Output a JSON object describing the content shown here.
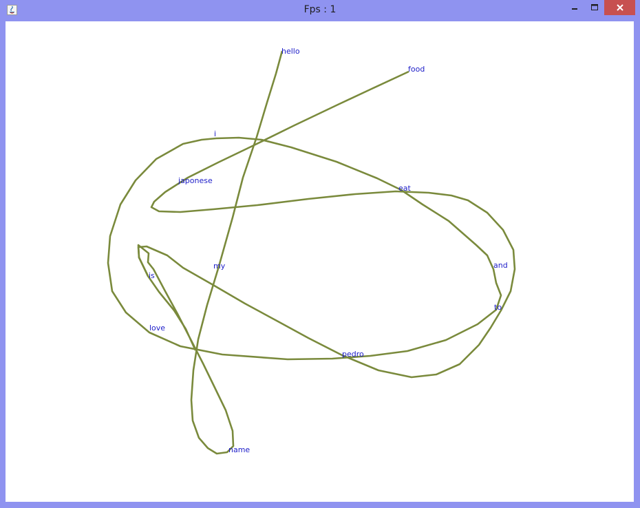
{
  "window": {
    "title": "Fps : 1"
  },
  "colors": {
    "frame": "#8f93f0",
    "canvas": "#ffffff",
    "curve": "#7a8a3c",
    "label": "#1c1cc8",
    "close": "#c75050"
  },
  "icons": [
    "java-app-icon",
    "minimize-icon",
    "maximize-icon",
    "close-icon"
  ],
  "graph": {
    "nodes": [
      {
        "label": "hello"
      },
      {
        "label": "food"
      },
      {
        "label": "i"
      },
      {
        "label": "japonese"
      },
      {
        "label": "eat"
      },
      {
        "label": "my"
      },
      {
        "label": "is"
      },
      {
        "label": "and"
      },
      {
        "label": "to"
      },
      {
        "label": "love"
      },
      {
        "label": "pedro"
      },
      {
        "label": "name"
      }
    ]
  }
}
